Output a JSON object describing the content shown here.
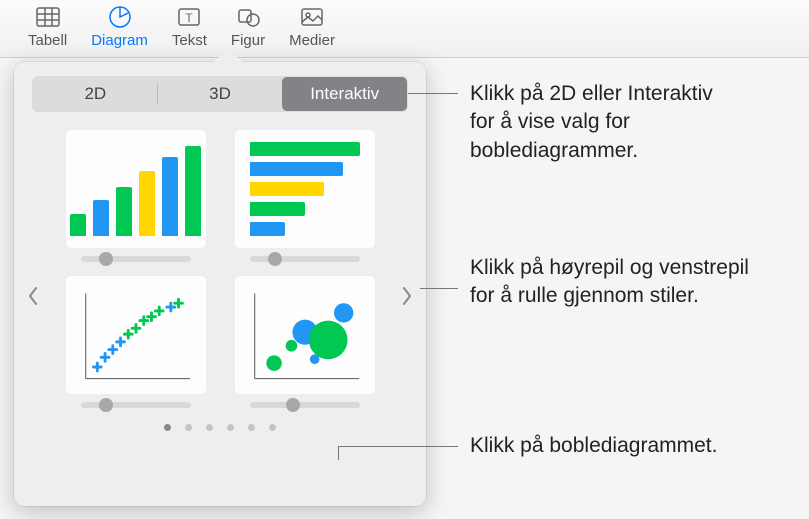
{
  "toolbar": {
    "items": [
      {
        "label": "Tabell",
        "icon": "table-icon"
      },
      {
        "label": "Diagram",
        "icon": "chart-icon",
        "active": true
      },
      {
        "label": "Tekst",
        "icon": "text-icon"
      },
      {
        "label": "Figur",
        "icon": "shape-icon"
      },
      {
        "label": "Medier",
        "icon": "media-icon"
      }
    ]
  },
  "segments": {
    "tab_2d": "2D",
    "tab_3d": "3D",
    "tab_interactive": "Interaktiv",
    "active": "Interaktiv"
  },
  "charts": {
    "types": [
      "column-bar",
      "horizontal-bar",
      "scatter",
      "bubble"
    ],
    "colors": {
      "green": "#00c853",
      "blue": "#2196f3",
      "yellow": "#ffd600"
    }
  },
  "pager": {
    "count": 6,
    "active_index": 0
  },
  "callouts": {
    "tabs_hint": "Klikk på 2D eller Interaktiv for å vise valg for boblediagrammer.",
    "arrows_hint": "Klikk på høyrepil og venstrepil for å rulle gjennom stiler.",
    "bubble_hint": "Klikk på boblediagrammet."
  }
}
